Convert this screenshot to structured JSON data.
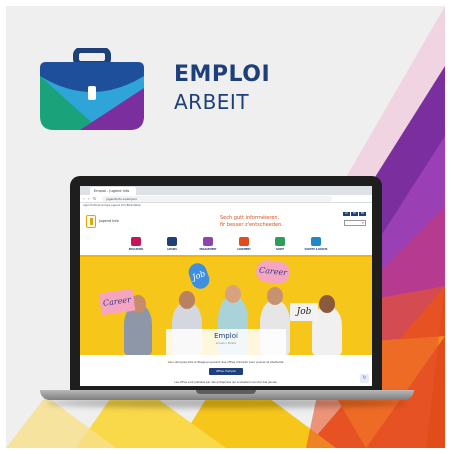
{
  "brand": {
    "title": "EMPLOI",
    "subtitle": "ARBEIT"
  },
  "browser": {
    "tab_title": "Emploi - Jugend Info",
    "url": "jugendinfo.lu/emploi",
    "bookmarks": "Apps  Hotmail  Google  Jugend Info  Biblioteken"
  },
  "site": {
    "name": "Jugend Info",
    "slogan_line1": "Sech gutt informéieren,",
    "slogan_line2": "fir besser z'entscheeden.",
    "languages": [
      "LU",
      "FR",
      "EN"
    ],
    "nav": [
      {
        "label": "EDUCATION",
        "color": "#c2185b"
      },
      {
        "label": "LOISIRS",
        "color": "#1d3f7a"
      },
      {
        "label": "ENGAGEMENT",
        "color": "#8e44ad"
      },
      {
        "label": "LOGEMENT",
        "color": "#e24c1b"
      },
      {
        "label": "SANTÉ",
        "color": "#2e9c5a"
      },
      {
        "label": "SOCIÉTÉ & DROITS",
        "color": "#1e88c9"
      }
    ]
  },
  "hero": {
    "signs": [
      "Career",
      "Job",
      "Career",
      "Job"
    ],
    "title": "Emploi",
    "breadcrumb": "Accueil > Emploi"
  },
  "content": {
    "intro": "Les rubriques Jobs & Stage proposent des offres d'emploi pour jeunes et étudiants.",
    "cta_label": "Offres d'emploi",
    "footer_note": "Les offres sont publiées par des entreprises qui souhaitent recruter des jeunes."
  },
  "colors": {
    "brand_blue": "#1d3f7a",
    "accent_yellow": "#f6c61b",
    "accent_orange": "#e24c1b",
    "accent_purple": "#7b2f9e"
  }
}
